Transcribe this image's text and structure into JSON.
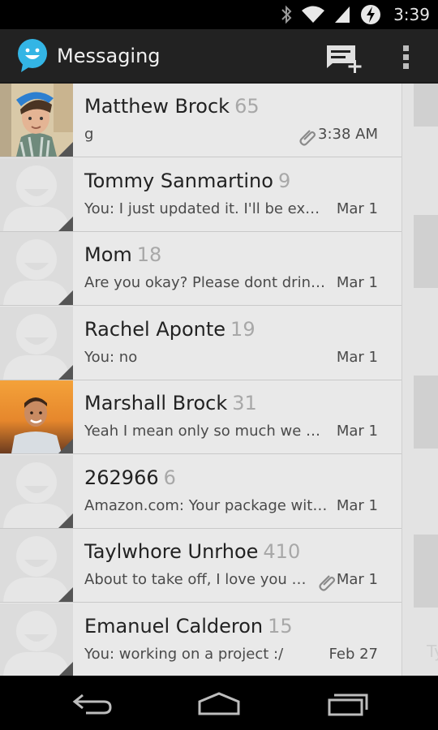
{
  "status_bar": {
    "time": "3:39",
    "icons": [
      "bluetooth-icon",
      "wifi-icon",
      "signal-icon",
      "battery-charging-icon"
    ]
  },
  "action_bar": {
    "title": "Messaging",
    "icons": [
      "messaging-app-icon",
      "new-message-icon",
      "overflow-menu-icon"
    ]
  },
  "conversations": [
    {
      "name": "Matthew Brock",
      "count": "65",
      "snippet": "g",
      "date": "3:38 AM",
      "attachment": true,
      "photo": "matthew"
    },
    {
      "name": "Tommy Sanmartino",
      "count": "9",
      "snippet": "You: I just updated it. I'll be expecting it",
      "date": "Mar 1",
      "attachment": false,
      "photo": ""
    },
    {
      "name": "Mom",
      "count": "18",
      "snippet": "Are you okay? Please dont drink and drive",
      "date": "Mar 1",
      "attachment": false,
      "photo": ""
    },
    {
      "name": "Rachel Aponte",
      "count": "19",
      "snippet": "You: no",
      "date": "Mar 1",
      "attachment": false,
      "photo": ""
    },
    {
      "name": "Marshall Brock",
      "count": "31",
      "snippet": "Yeah I mean only so much we can do about it",
      "date": "Mar 1",
      "attachment": false,
      "photo": "marshall"
    },
    {
      "name": "262966",
      "count": "6",
      "snippet": "Amazon.com: Your package with order has shipped",
      "date": "Mar 1",
      "attachment": false,
      "photo": ""
    },
    {
      "name": "Taylwhore Unrhoe",
      "count": "410",
      "snippet": "About to take off, I love you more than",
      "date": "Mar 1",
      "attachment": true,
      "photo": ""
    },
    {
      "name": "Emanuel Calderon",
      "count": "15",
      "snippet": "You: working on a project :/",
      "date": "Feb 27",
      "attachment": false,
      "photo": ""
    }
  ],
  "right_panel": {
    "input_hint": "Ty"
  },
  "nav_bar": {
    "icons": [
      "back-icon",
      "home-icon",
      "recent-apps-icon"
    ]
  }
}
